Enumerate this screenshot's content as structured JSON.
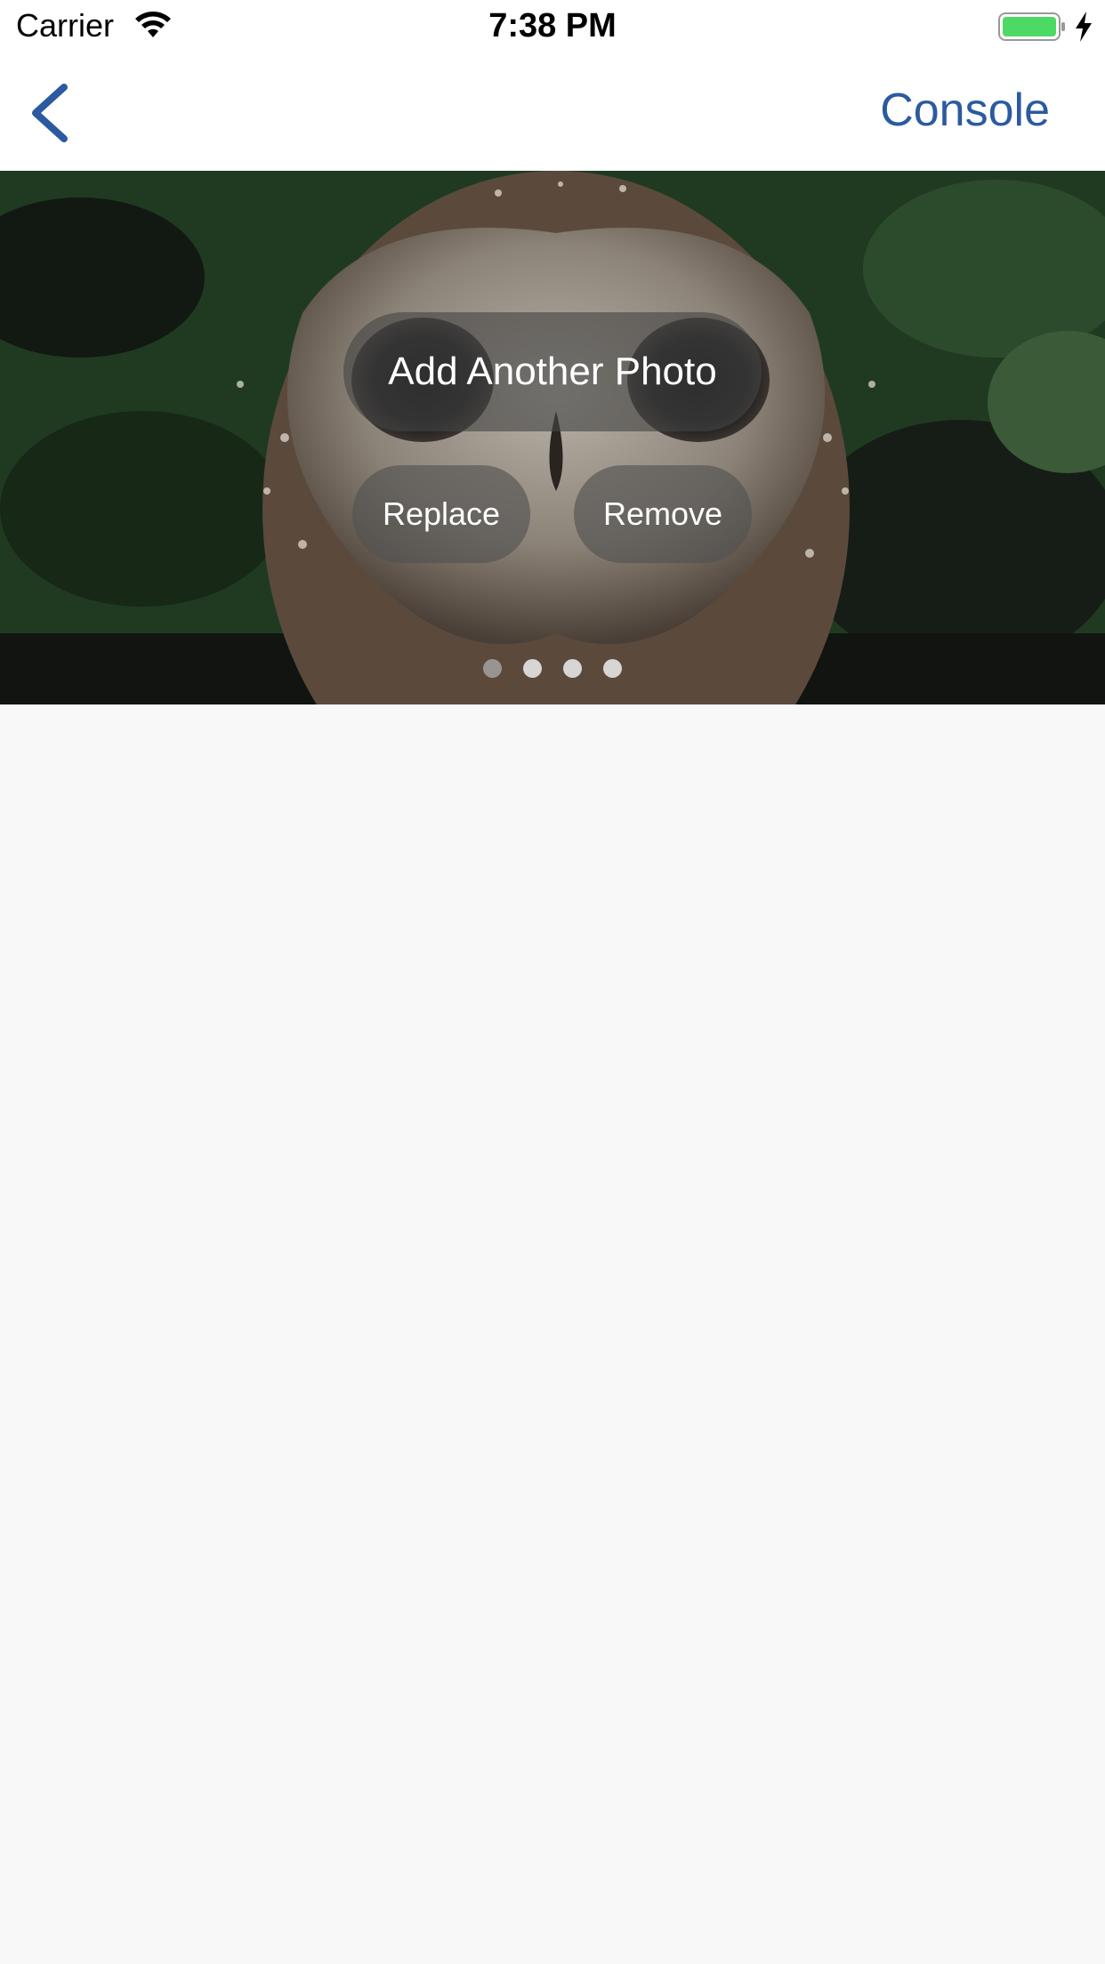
{
  "status_bar": {
    "carrier": "Carrier",
    "time": "7:38 PM",
    "wifi_icon": "wifi-icon",
    "battery_icon": "battery-icon",
    "charging_icon": "bolt-icon",
    "battery_color": "#4cd964"
  },
  "nav_bar": {
    "back_icon": "chevron-left-icon",
    "console_label": "Console",
    "accent_color": "#2b5aa0"
  },
  "photo": {
    "add_photo_label": "Add Another Photo",
    "replace_label": "Replace",
    "remove_label": "Remove",
    "page_count": 4,
    "current_page": 1
  }
}
